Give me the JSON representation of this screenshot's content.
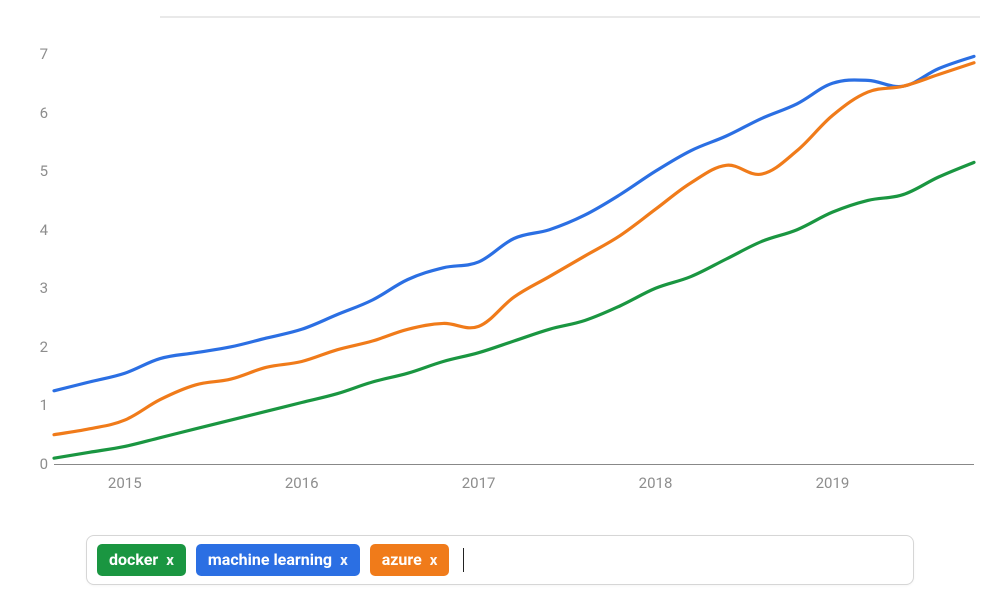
{
  "chart_data": {
    "type": "line",
    "xlabel": "",
    "ylabel": "",
    "ylim": [
      0,
      7
    ],
    "x_range": [
      2014.6,
      2019.8
    ],
    "x_ticks": [
      2015,
      2016,
      2017,
      2018,
      2019
    ],
    "y_ticks": [
      0,
      1,
      2,
      3,
      4,
      5,
      6,
      7
    ],
    "x": [
      2014.6,
      2014.8,
      2015.0,
      2015.2,
      2015.4,
      2015.6,
      2015.8,
      2016.0,
      2016.2,
      2016.4,
      2016.6,
      2016.8,
      2017.0,
      2017.2,
      2017.4,
      2017.6,
      2017.8,
      2018.0,
      2018.2,
      2018.4,
      2018.6,
      2018.8,
      2019.0,
      2019.2,
      2019.4,
      2019.6,
      2019.8
    ],
    "series": [
      {
        "name": "docker",
        "color": "#1a9641",
        "values": [
          0.1,
          0.2,
          0.3,
          0.45,
          0.6,
          0.75,
          0.9,
          1.05,
          1.2,
          1.4,
          1.55,
          1.75,
          1.9,
          2.1,
          2.3,
          2.45,
          2.7,
          3.0,
          3.2,
          3.5,
          3.8,
          4.0,
          4.3,
          4.5,
          4.6,
          4.9,
          5.15
        ]
      },
      {
        "name": "machine learning",
        "color": "#2b6fe3",
        "values": [
          1.25,
          1.4,
          1.55,
          1.8,
          1.9,
          2.0,
          2.15,
          2.3,
          2.55,
          2.8,
          3.15,
          3.35,
          3.45,
          3.85,
          4.0,
          4.25,
          4.6,
          5.0,
          5.35,
          5.6,
          5.9,
          6.15,
          6.5,
          6.55,
          6.45,
          6.75,
          6.96
        ]
      },
      {
        "name": "azure",
        "color": "#f07b1a",
        "values": [
          0.5,
          0.6,
          0.75,
          1.1,
          1.35,
          1.45,
          1.65,
          1.75,
          1.95,
          2.1,
          2.3,
          2.4,
          2.35,
          2.85,
          3.2,
          3.55,
          3.9,
          4.35,
          4.8,
          5.1,
          4.95,
          5.35,
          5.95,
          6.35,
          6.45,
          6.65,
          6.85
        ]
      }
    ]
  },
  "tags": [
    {
      "label": "docker",
      "close": "x",
      "color": "#1a9641"
    },
    {
      "label": "machine learning",
      "close": "x",
      "color": "#2b6fe3"
    },
    {
      "label": "azure",
      "close": "x",
      "color": "#f07b1a"
    }
  ]
}
